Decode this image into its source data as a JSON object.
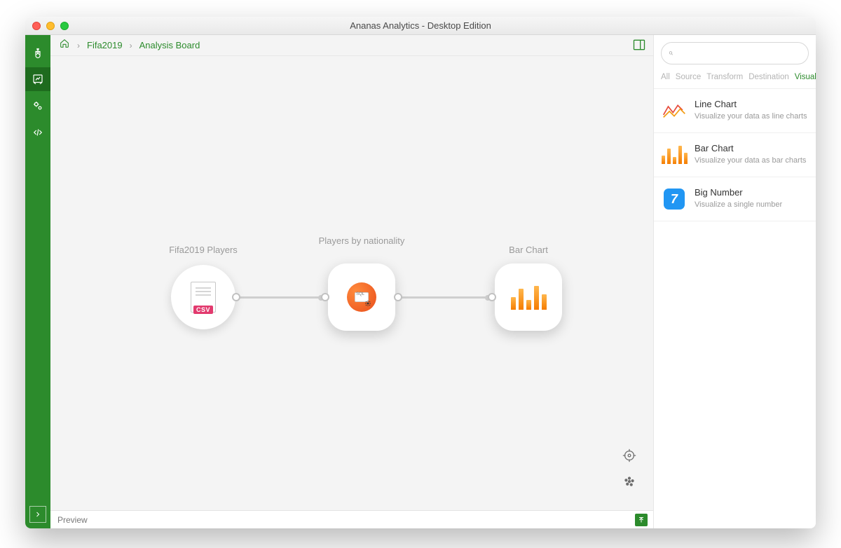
{
  "window": {
    "title": "Ananas Analytics - Desktop Edition"
  },
  "breadcrumb": {
    "project": "Fifa2019",
    "page": "Analysis Board"
  },
  "sidebar": {
    "items": [
      {
        "name": "home-icon"
      },
      {
        "name": "board-icon"
      },
      {
        "name": "settings-icon"
      },
      {
        "name": "code-icon"
      }
    ],
    "active_index": 1
  },
  "canvas": {
    "nodes": [
      {
        "id": "src",
        "label": "Fifa2019 Players",
        "type": "csv"
      },
      {
        "id": "tr",
        "label": "Players by nationality",
        "type": "sql"
      },
      {
        "id": "viz",
        "label": "Bar Chart",
        "type": "barchart"
      }
    ]
  },
  "preview": {
    "label": "Preview"
  },
  "rightpanel": {
    "search_placeholder": "",
    "filters": [
      "All",
      "Source",
      "Transform",
      "Destination",
      "Visualization"
    ],
    "active_filter": 4,
    "items": [
      {
        "title": "Line Chart",
        "desc": "Visualize your data as line charts",
        "icon": "line"
      },
      {
        "title": "Bar Chart",
        "desc": "Visualize your data as bar charts",
        "icon": "bar"
      },
      {
        "title": "Big Number",
        "desc": "Visualize a single number",
        "icon": "bignum",
        "glyph": "7"
      }
    ]
  }
}
